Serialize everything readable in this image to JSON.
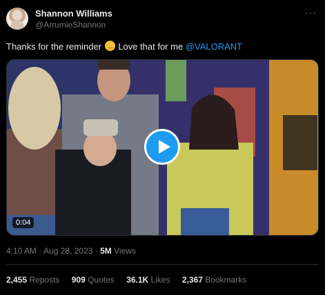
{
  "author": {
    "display_name": "Shannon Williams",
    "handle": "@ArrumieShannon",
    "avatar_icon": "profile-photo"
  },
  "more_icon": "more-horizontal-icon",
  "tweet": {
    "text_before_emoji": "Thanks for the reminder ",
    "emoji": "melting-face-emoji",
    "text_after_emoji": " Love that for me ",
    "mention": "@VALORANT"
  },
  "video": {
    "duration": "0:04",
    "play_icon": "play-icon"
  },
  "meta": {
    "time": "4:10 AM · Aug 28, 2023 · ",
    "views_count": "5M",
    "views_label": " Views"
  },
  "stats": [
    {
      "count": "2,455",
      "label": "Reposts"
    },
    {
      "count": "909",
      "label": "Quotes"
    },
    {
      "count": "36.1K",
      "label": "Likes"
    },
    {
      "count": "2,367",
      "label": "Bookmarks"
    }
  ],
  "colors": {
    "background": "#000000",
    "accent": "#1d9bf0",
    "secondary_text": "#71767b",
    "primary_text": "#e7e9ea"
  }
}
